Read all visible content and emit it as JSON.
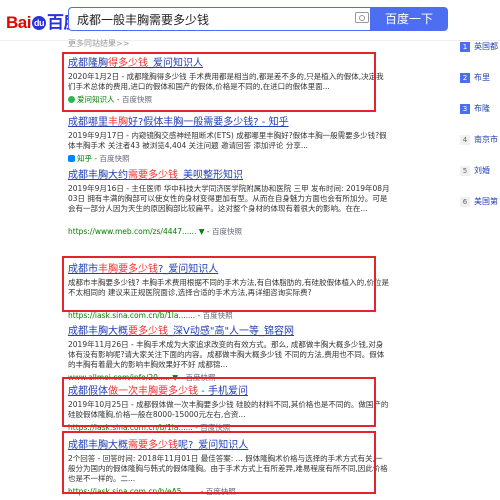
{
  "header": {
    "logo_left": "Bai",
    "logo_mid": "du",
    "logo_right": "百度",
    "query": "成都一般丰胸需要多少钱",
    "search_button": "百度一下"
  },
  "hint": "更多同站结果>>",
  "results": [
    {
      "title_pre": "成都隆胸",
      "title_em": "得多少钱",
      "title_post": "_爱问知识人",
      "abstract": "2020年1月2日 - 成都隆胸得多少钱 手术费用都是相当的,都是差不多的,只是植入的假体,决定我们手术总体的费用,进口的假体和国产的假体,价格是不同的,在进口的假体里面...",
      "source": "爱问知识人",
      "snapshot": "百度快照"
    },
    {
      "title_pre": "成都哪里",
      "title_em": "丰胸",
      "title_post": "好?假体丰胸一般需要多少钱? - 知乎",
      "abstract": "2019年9月17日 - 内窥镜胸交感神经阻断术(ETS) 成都哪里丰胸好?假体丰胸一般需要多少钱?假体丰胸手术 关注者43 被浏览4,404 关注问题 邀请回答 添加评论 分享...",
      "source": "知乎",
      "snapshot": "百度快照"
    },
    {
      "title_pre": "成都丰胸大约",
      "title_em": "需要多少钱",
      "title_post": "_美呗整形知识",
      "abstract": "2019年9月16日 - 主任医师 华中科技大学同济医学院附属协和医院 三甲 发布时间: 2019年08月03日 拥有丰满的胸部可以使女性的身材变得更加有型。从而在自身魅力方面也会有所加分。可是会有一部分人因为天生的原因胸部比较扁平。这对整个身材的体现有着很大的影响。在在...",
      "source": "https://www.meb.com/zs/4447...... ▼",
      "snapshot": "百度快照"
    },
    {
      "title_pre": "成都市",
      "title_em": "丰胸要多少钱",
      "title_post": "?_爱问知识人",
      "abstract": "成都市丰胸要多少钱? 丰胸手术费用根据不同的手术方法,有自体脂肪的,有硅胶假体植入的,价位是不太相同的 建议来正规医院面诊,选择合适的手术方法,再详细咨询实际费?",
      "source": "https://iask.sina.com.cn/b/1la.......",
      "snapshot": "百度快照"
    },
    {
      "title_pre": "成都丰胸大概",
      "title_em": "要多少钱",
      "title_post": "_深V动感\"高\"人一等_锦容网",
      "abstract": "2019年11月26日 - 丰胸手术成为大家追求改变的有效方式。那么, 成都做丰胸大概多少钱,对身体有没有影响呢?请大家关注下面的内容。成都做丰胸大概多少钱 不同的方法,费用也不同。假体的丰胸有着最大的影响丰胸效果好不好 成都锦...",
      "source": "www.allmei.com/info/20..... ▼",
      "snapshot": "百度快照"
    },
    {
      "title_pre": "成都假体",
      "title_em": "做一次丰胸要多少钱",
      "title_post": " - 手机爱问",
      "abstract": "2019年10月25日 - 成都假体做一次丰胸要多少钱 硅胶的材料不同,其价格也是不同的。做国产的硅胶假体隆胸,价格一般在8000-15000元左右,合资...",
      "source": "https://iask.sina.com.cn/b/1la......",
      "snapshot": "百度快照"
    },
    {
      "title_pre": "成都丰胸大概",
      "title_em": "需要多少钱",
      "title_post": "呢?_爱问知识人",
      "abstract": "2个回答 - 回答时间: 2018年11月01日 最佳答案: ... 假体隆胸术价格与选择的手术方式有关,一般分为国内的假体隆胸与韩式的假体隆胸。由于手术方式上有所差异,难易程度有所不同,因此价格也是不一样的。二...",
      "source": "https://iask.sina.com.cn/b/eA5.......",
      "snapshot": "百度快照"
    }
  ],
  "right_items": [
    {
      "num": "1",
      "label": "英国都"
    },
    {
      "num": "2",
      "label": "布里"
    },
    {
      "num": "3",
      "label": "布隆"
    },
    {
      "num": "4",
      "label": "南京市"
    },
    {
      "num": "5",
      "label": "刘婚"
    },
    {
      "num": "6",
      "label": "美国第"
    }
  ]
}
